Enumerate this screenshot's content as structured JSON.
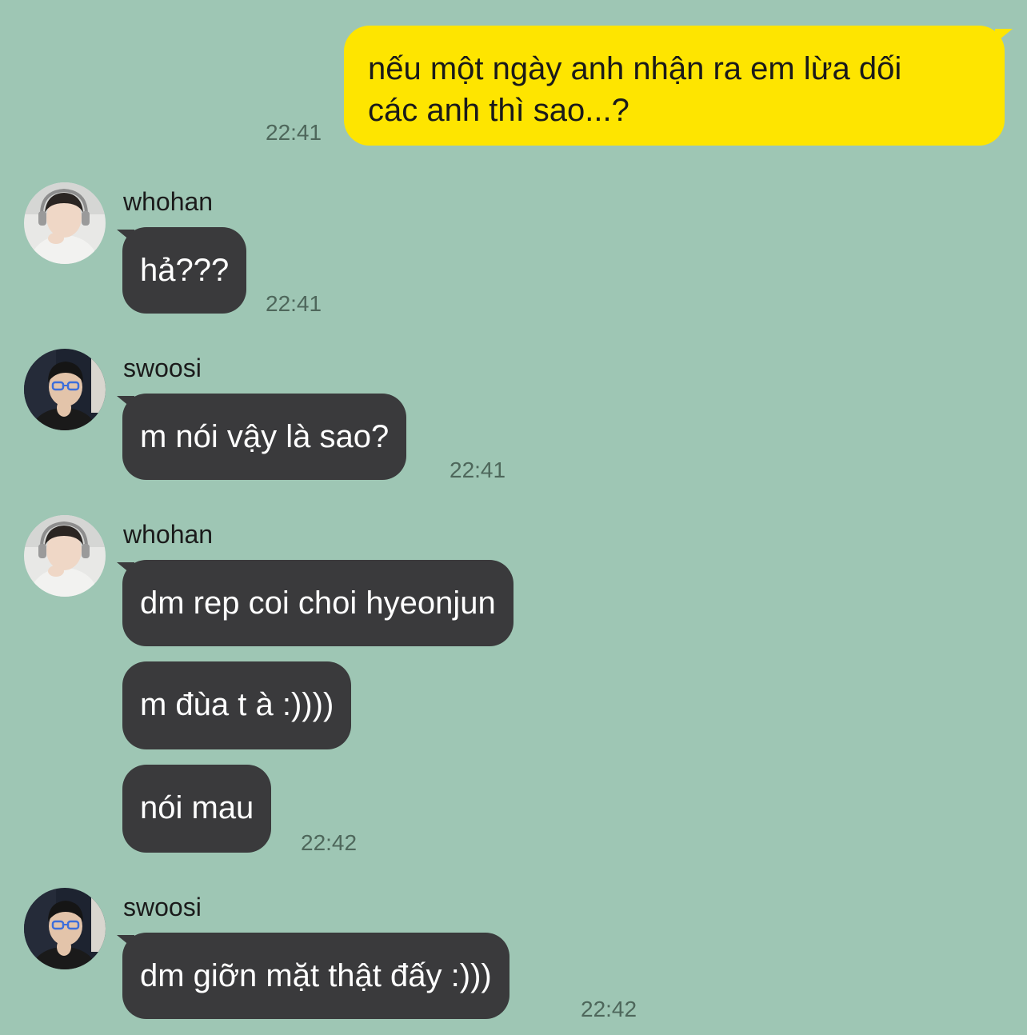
{
  "colors": {
    "background": "#9ec6b4",
    "outgoing_bubble": "#fee500",
    "incoming_bubble": "#3a3a3c",
    "timestamp": "#4e675b"
  },
  "messages": {
    "out1": {
      "line1": "nếu một ngày anh nhận ra em lừa dối",
      "line2": "các anh thì sao...?",
      "time": "22:41"
    },
    "group1": {
      "sender": "whohan",
      "avatar_icon": "user-avatar-headset",
      "msg1": "hả???",
      "time": "22:41"
    },
    "group2": {
      "sender": "swoosi",
      "avatar_icon": "user-avatar-glasses",
      "msg1": "m nói vậy là sao?",
      "time": "22:41"
    },
    "group3": {
      "sender": "whohan",
      "avatar_icon": "user-avatar-headset",
      "msg1": "dm rep coi choi hyeonjun",
      "msg2": "m đùa t à :))))",
      "msg3": "nói mau",
      "time": "22:42"
    },
    "group4": {
      "sender": "swoosi",
      "avatar_icon": "user-avatar-glasses",
      "msg1": "dm giỡn mặt thật đấy :)))",
      "time": "22:42"
    }
  }
}
